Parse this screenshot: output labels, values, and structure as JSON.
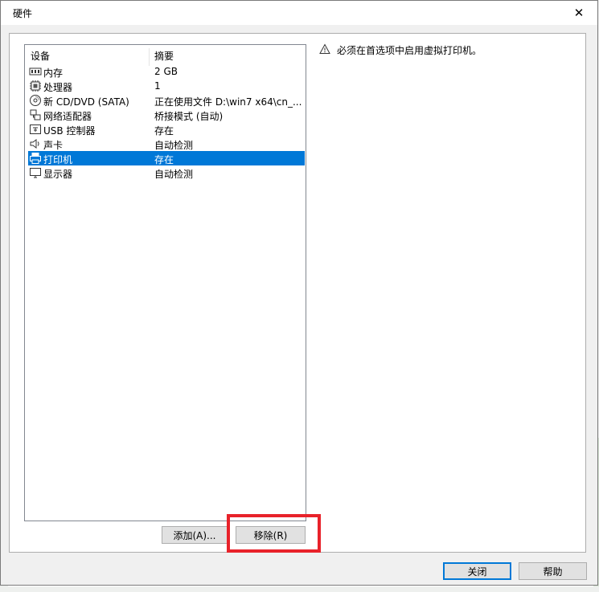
{
  "dialog": {
    "title": "硬件",
    "close_glyph": "✕"
  },
  "list": {
    "headers": {
      "device": "设备",
      "summary": "摘要"
    },
    "rows": [
      {
        "icon": "memory-icon",
        "name": "内存",
        "summary": "2 GB"
      },
      {
        "icon": "cpu-icon",
        "name": "处理器",
        "summary": "1"
      },
      {
        "icon": "cd-dvd-icon",
        "name": "新 CD/DVD (SATA)",
        "summary": "正在使用文件 D:\\win7 x64\\cn_..."
      },
      {
        "icon": "network-icon",
        "name": "网络适配器",
        "summary": "桥接模式 (自动)"
      },
      {
        "icon": "usb-icon",
        "name": "USB 控制器",
        "summary": "存在"
      },
      {
        "icon": "sound-icon",
        "name": "声卡",
        "summary": "自动检测"
      },
      {
        "icon": "printer-icon",
        "name": "打印机",
        "summary": "存在",
        "selected": true
      },
      {
        "icon": "display-icon",
        "name": "显示器",
        "summary": "自动检测"
      }
    ]
  },
  "warning": {
    "icon": "warning-icon",
    "text": "必须在首选项中启用虚拟打印机。"
  },
  "buttons": {
    "add": "添加(A)...",
    "remove": "移除(R)",
    "close": "关闭",
    "help": "帮助"
  },
  "colors": {
    "selection": "#0078d7",
    "highlight_box": "#e8222a"
  }
}
